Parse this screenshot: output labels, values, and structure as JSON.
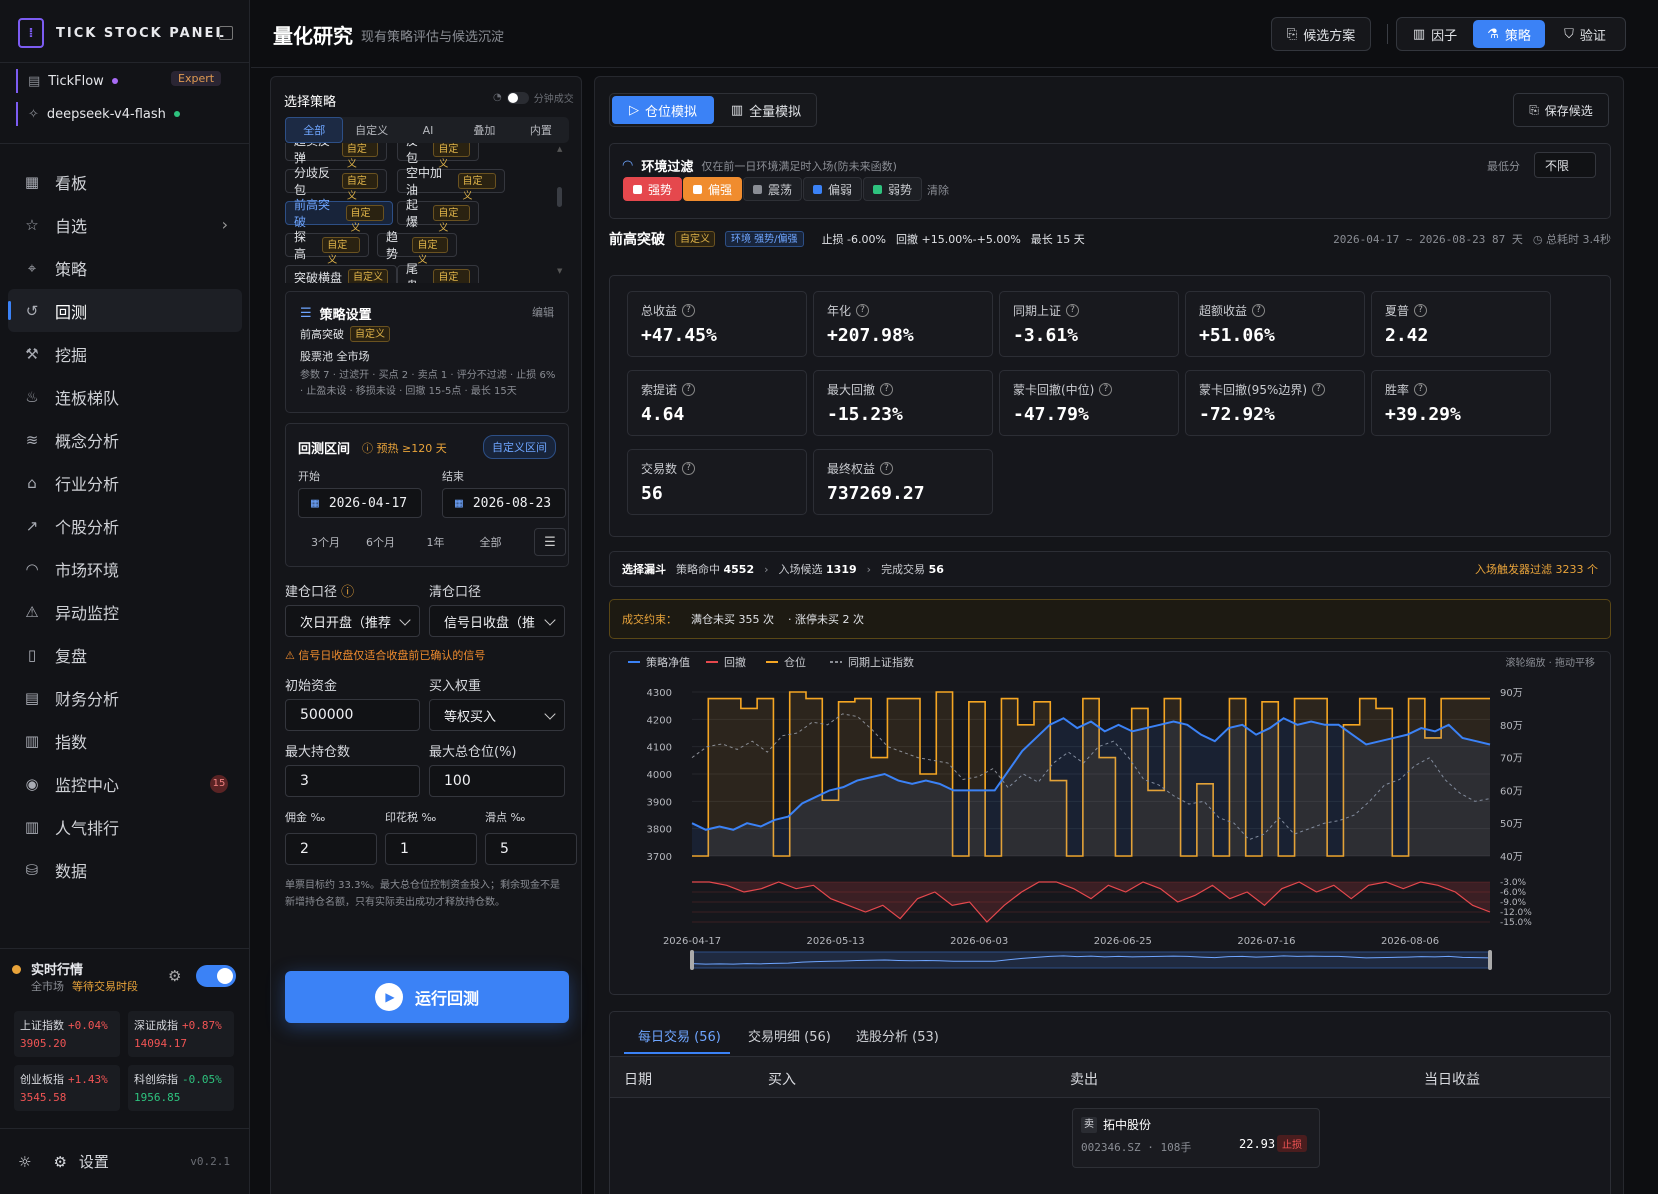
{
  "brand": {
    "name": "TICK STOCK PANEL",
    "logo": "[ | ]"
  },
  "accounts": [
    {
      "name": "TickFlow",
      "badge": "Expert",
      "dot": "#a86bf5"
    },
    {
      "name": "deepseek-v4-flash",
      "dot": "#2ec27e"
    }
  ],
  "nav": [
    {
      "label": "看板",
      "icon": "grid-icon"
    },
    {
      "label": "自选",
      "icon": "star-icon",
      "chevron": "›"
    },
    {
      "label": "策略",
      "icon": "scan-icon"
    },
    {
      "label": "回测",
      "icon": "history-icon",
      "active": true
    },
    {
      "label": "挖掘",
      "icon": "pickaxe-icon"
    },
    {
      "label": "连板梯队",
      "icon": "flame-icon"
    },
    {
      "label": "概念分析",
      "icon": "layers-icon"
    },
    {
      "label": "行业分析",
      "icon": "building-icon"
    },
    {
      "label": "个股分析",
      "icon": "trend-icon"
    },
    {
      "label": "市场环境",
      "icon": "gauge-icon"
    },
    {
      "label": "异动监控",
      "icon": "alert-icon"
    },
    {
      "label": "复盘",
      "icon": "book-icon"
    },
    {
      "label": "财务分析",
      "icon": "file-icon"
    },
    {
      "label": "指数",
      "icon": "bar-icon"
    },
    {
      "label": "监控中心",
      "icon": "radio-icon",
      "count": "15"
    },
    {
      "label": "人气排行",
      "icon": "rank-icon"
    },
    {
      "label": "数据",
      "icon": "database-icon"
    }
  ],
  "realtime": {
    "title": "实时行情",
    "scope": "全市场",
    "status": "等待交易时段"
  },
  "indices": [
    {
      "name": "上证指数",
      "change": "+0.04%",
      "value": "3905.20",
      "dir": "up"
    },
    {
      "name": "深证成指",
      "change": "+0.87%",
      "value": "14094.17",
      "dir": "up"
    },
    {
      "name": "创业板指",
      "change": "+1.43%",
      "value": "3545.58",
      "dir": "up"
    },
    {
      "name": "科创综指",
      "change": "-0.05%",
      "value": "1956.85",
      "dir": "dn"
    }
  ],
  "footer": {
    "settings": "设置",
    "version": "v0.2.1"
  },
  "header": {
    "title": "量化研究",
    "subtitle": "现有策略评估与候选沉淀",
    "candidates": "候选方案",
    "factor": "因子",
    "strategy": "策略",
    "verify": "验证"
  },
  "left": {
    "select_title": "选择策略",
    "minute_label": "分钟成交",
    "tabs": [
      "全部",
      "自定义",
      "AI",
      "叠加",
      "内置"
    ],
    "chips": [
      {
        "name": "超卖反弹",
        "tag": "自定义"
      },
      {
        "name": "反包",
        "tag": "自定义"
      },
      {
        "name": "分歧反包",
        "tag": "自定义"
      },
      {
        "name": "空中加油",
        "tag": "自定义"
      },
      {
        "name": "前高突破",
        "tag": "自定义",
        "selected": true
      },
      {
        "name": "起爆",
        "tag": "自定义"
      },
      {
        "name": "探高",
        "tag": "自定义"
      },
      {
        "name": "趋势",
        "tag": "自定义"
      },
      {
        "name": "突破横盘",
        "tag": "自定义"
      },
      {
        "name": "尾盘",
        "tag": "自定义"
      }
    ],
    "settings_title": "策略设置",
    "edit": "编辑",
    "strategy_name": "前高突破",
    "strategy_tag": "自定义",
    "pool": "股票池 全市场",
    "params": "参数 7 · 过滤开 · 买点 2 · 卖点 1 · 评分不过滤 · 止损 6% · 止盈未设 · 移损未设 · 回撤 15-5点 · 最长 15天",
    "range_title": "回测区间",
    "warmup": "预热 ≥120 天",
    "custom_range": "自定义区间",
    "start_label": "开始",
    "end_label": "结束",
    "start": "2026-04-17",
    "end": "2026-08-23",
    "presets": [
      "3个月",
      "6个月",
      "1年",
      "全部"
    ],
    "open_label": "建仓口径",
    "close_label": "清仓口径",
    "open_value": "次日开盘（推荐",
    "close_value": "信号日收盘（推",
    "warning": "信号日收盘仅适合收盘前已确认的信号",
    "capital_label": "初始资金",
    "capital": "500000",
    "weight_label": "买入权重",
    "weight": "等权买入",
    "maxpos_label": "最大持仓数",
    "maxpos": "3",
    "maxratio_label": "最大总仓位(%)",
    "maxratio": "100",
    "comm_label": "佣金 ‰",
    "comm": "2",
    "stamp_label": "印花税 ‰",
    "stamp": "1",
    "slip_label": "滑点 ‰",
    "slip": "5",
    "note": "单票目标约 33.3%。最大总仓位控制资金投入；剩余现金不是新增持仓名额，只有实际卖出成功才释放持仓数。",
    "run": "运行回测"
  },
  "right": {
    "mode_tabs": [
      "仓位模拟",
      "全量模拟"
    ],
    "save": "保存候选",
    "env_title": "环境过滤",
    "env_desc": "仅在前一日环境满足时入场(防未来函数)",
    "min_score_label": "最低分",
    "min_score": "不限",
    "env_buttons": [
      {
        "label": "强势",
        "color": "#e5484d",
        "on": true
      },
      {
        "label": "偏强",
        "color": "#f08c2e",
        "on": true
      },
      {
        "label": "震荡",
        "color": "#8a8d94"
      },
      {
        "label": "偏弱",
        "color": "#3b82f6"
      },
      {
        "label": "弱势",
        "color": "#2ec27e"
      }
    ],
    "clear": "清除",
    "strategy": "前高突破",
    "tag": "自定义",
    "env_tag": "环境 强势/偏强",
    "stop": "止损 -6.00%",
    "drawdown": "回撤 +15.00%-+5.00%",
    "longest": "最长 15 天",
    "period": "2026-04-17 ~ 2026-08-23 87 天",
    "elapsed": "总耗时 3.4秒",
    "metrics": [
      {
        "label": "总收益",
        "value": "+47.45%",
        "dir": "up"
      },
      {
        "label": "年化",
        "value": "+207.98%",
        "dir": "up"
      },
      {
        "label": "同期上证",
        "value": "-3.61%",
        "dir": "dn"
      },
      {
        "label": "超额收益",
        "value": "+51.06%",
        "dir": "up"
      },
      {
        "label": "夏普",
        "value": "2.42",
        "dir": ""
      },
      {
        "label": "索提诺",
        "value": "4.64",
        "dir": ""
      },
      {
        "label": "最大回撤",
        "value": "-15.23%",
        "dir": "dn"
      },
      {
        "label": "蒙卡回撤(中位)",
        "value": "-47.79%",
        "dir": "dn"
      },
      {
        "label": "蒙卡回撤(95%边界)",
        "value": "-72.92%",
        "dir": "dn"
      },
      {
        "label": "胜率",
        "value": "+39.29%",
        "dir": ""
      },
      {
        "label": "交易数",
        "value": "56",
        "dir": ""
      },
      {
        "label": "最终权益",
        "value": "737269.27",
        "dir": ""
      }
    ],
    "funnel": {
      "title": "选择漏斗",
      "hit_label": "策略命中",
      "hit": "4552",
      "cand_label": "入场候选",
      "cand": "1319",
      "done_label": "完成交易",
      "done": "56",
      "trigger": "入场触发器过滤 3233 个"
    },
    "constraint": {
      "label": "成交约束：",
      "full": "满仓未买 355 次",
      "limit": "· 涨停未买 2 次"
    },
    "legend": [
      "策略净值",
      "回撤",
      "仓位",
      "同期上证指数"
    ],
    "chart_hint": "滚轮缩放 · 拖动平移",
    "table_tabs": [
      "每日交易 (56)",
      "交易明细 (56)",
      "选股分析 (53)"
    ],
    "table_headers": [
      "日期",
      "买入",
      "卖出",
      "当日收益"
    ],
    "first_row": {
      "side": "卖",
      "stock": "拓中股份",
      "code": "002346.SZ · 108手",
      "price": "22.93",
      "reason": "止损"
    }
  },
  "colors": {
    "accent": "#3b82f6",
    "up": "#f05454",
    "down": "#2ec27e",
    "position": "#f5a623",
    "drawdown": "#e5484d"
  },
  "chart_data": {
    "type": "line",
    "x": [
      "2026-04-17",
      "2026-05-13",
      "2026-06-03",
      "2026-06-25",
      "2026-07-16",
      "2026-08-06"
    ],
    "x_ticks": [
      "2026-04-17",
      "2026-05-13",
      "2026-06-03",
      "2026-06-25",
      "2026-07-16",
      "2026-08-06"
    ],
    "y_left_ticks": [
      "4300",
      "4200",
      "4100",
      "4000",
      "3900",
      "3800",
      "3700"
    ],
    "y_right_ticks": [
      "90万",
      "80万",
      "70万",
      "60万",
      "50万",
      "40万"
    ],
    "dd_ticks": [
      "-3.0%",
      "-6.0%",
      "-9.0%",
      "-12.0%",
      "-15.0%"
    ],
    "ylim_left": [
      3700,
      4300
    ],
    "ylim_right": [
      40,
      90
    ],
    "series": [
      {
        "name": "策略净值",
        "axis": "right",
        "color": "#3b82f6",
        "values": [
          50,
          48,
          49,
          48,
          50,
          49,
          51,
          52,
          56,
          58,
          60,
          61,
          63,
          64,
          65,
          63,
          62,
          63,
          62,
          60,
          60,
          60,
          60,
          66,
          72,
          76,
          80,
          82,
          79,
          81,
          78,
          80,
          78,
          79,
          80,
          81,
          80,
          77,
          75,
          79,
          80,
          77,
          79,
          82,
          80,
          81,
          80,
          80,
          77,
          74,
          75,
          76,
          77,
          79,
          78,
          80,
          76,
          75,
          74
        ]
      },
      {
        "name": "同期上证指数",
        "axis": "left",
        "color": "#8a8d94",
        "values": [
          4060,
          4100,
          4110,
          4090,
          4120,
          4080,
          4140,
          4150,
          4190,
          4180,
          4220,
          4210,
          4160,
          4100,
          4080,
          4060,
          4050,
          4040,
          3980,
          3990,
          4020,
          3950,
          4000,
          3970,
          4040,
          4080,
          4040,
          4100,
          4120,
          4060,
          3980,
          3960,
          3920,
          3890,
          3900,
          3840,
          3820,
          3760,
          3780,
          3840,
          3780,
          3800,
          3820,
          3830,
          3850,
          3900,
          3960,
          3980,
          4030,
          4060,
          3980,
          3930,
          3900,
          3910
        ]
      },
      {
        "name": "仓位",
        "axis": "right",
        "color": "#f5a623",
        "values": [
          40,
          88,
          88,
          85,
          88,
          40,
          90,
          88,
          57,
          87,
          88,
          70,
          88,
          88,
          65,
          90,
          40,
          87,
          40,
          88,
          80,
          87,
          63,
          40,
          88,
          70,
          40,
          85,
          60,
          88,
          40,
          62,
          40,
          88,
          40,
          87,
          40,
          88,
          88,
          40,
          80,
          88,
          85,
          40,
          88,
          76,
          88,
          88,
          88
        ]
      },
      {
        "name": "回撤",
        "axis": "dd",
        "color": "#e5484d",
        "values": [
          -1,
          -2,
          -4,
          -6,
          -5,
          -3,
          -5,
          -4,
          -8,
          -10,
          -12,
          -10,
          -14,
          -8,
          -6,
          -10,
          -9,
          -15,
          -10,
          -6,
          -3,
          -2,
          -5,
          -8,
          -4,
          -6,
          -2,
          -5,
          -9,
          -7,
          -4,
          -8,
          -6,
          -10,
          -5,
          -3,
          -6,
          -4,
          -8,
          -4,
          -3,
          -5,
          -2,
          -4,
          -6,
          -10,
          -12
        ]
      }
    ]
  }
}
